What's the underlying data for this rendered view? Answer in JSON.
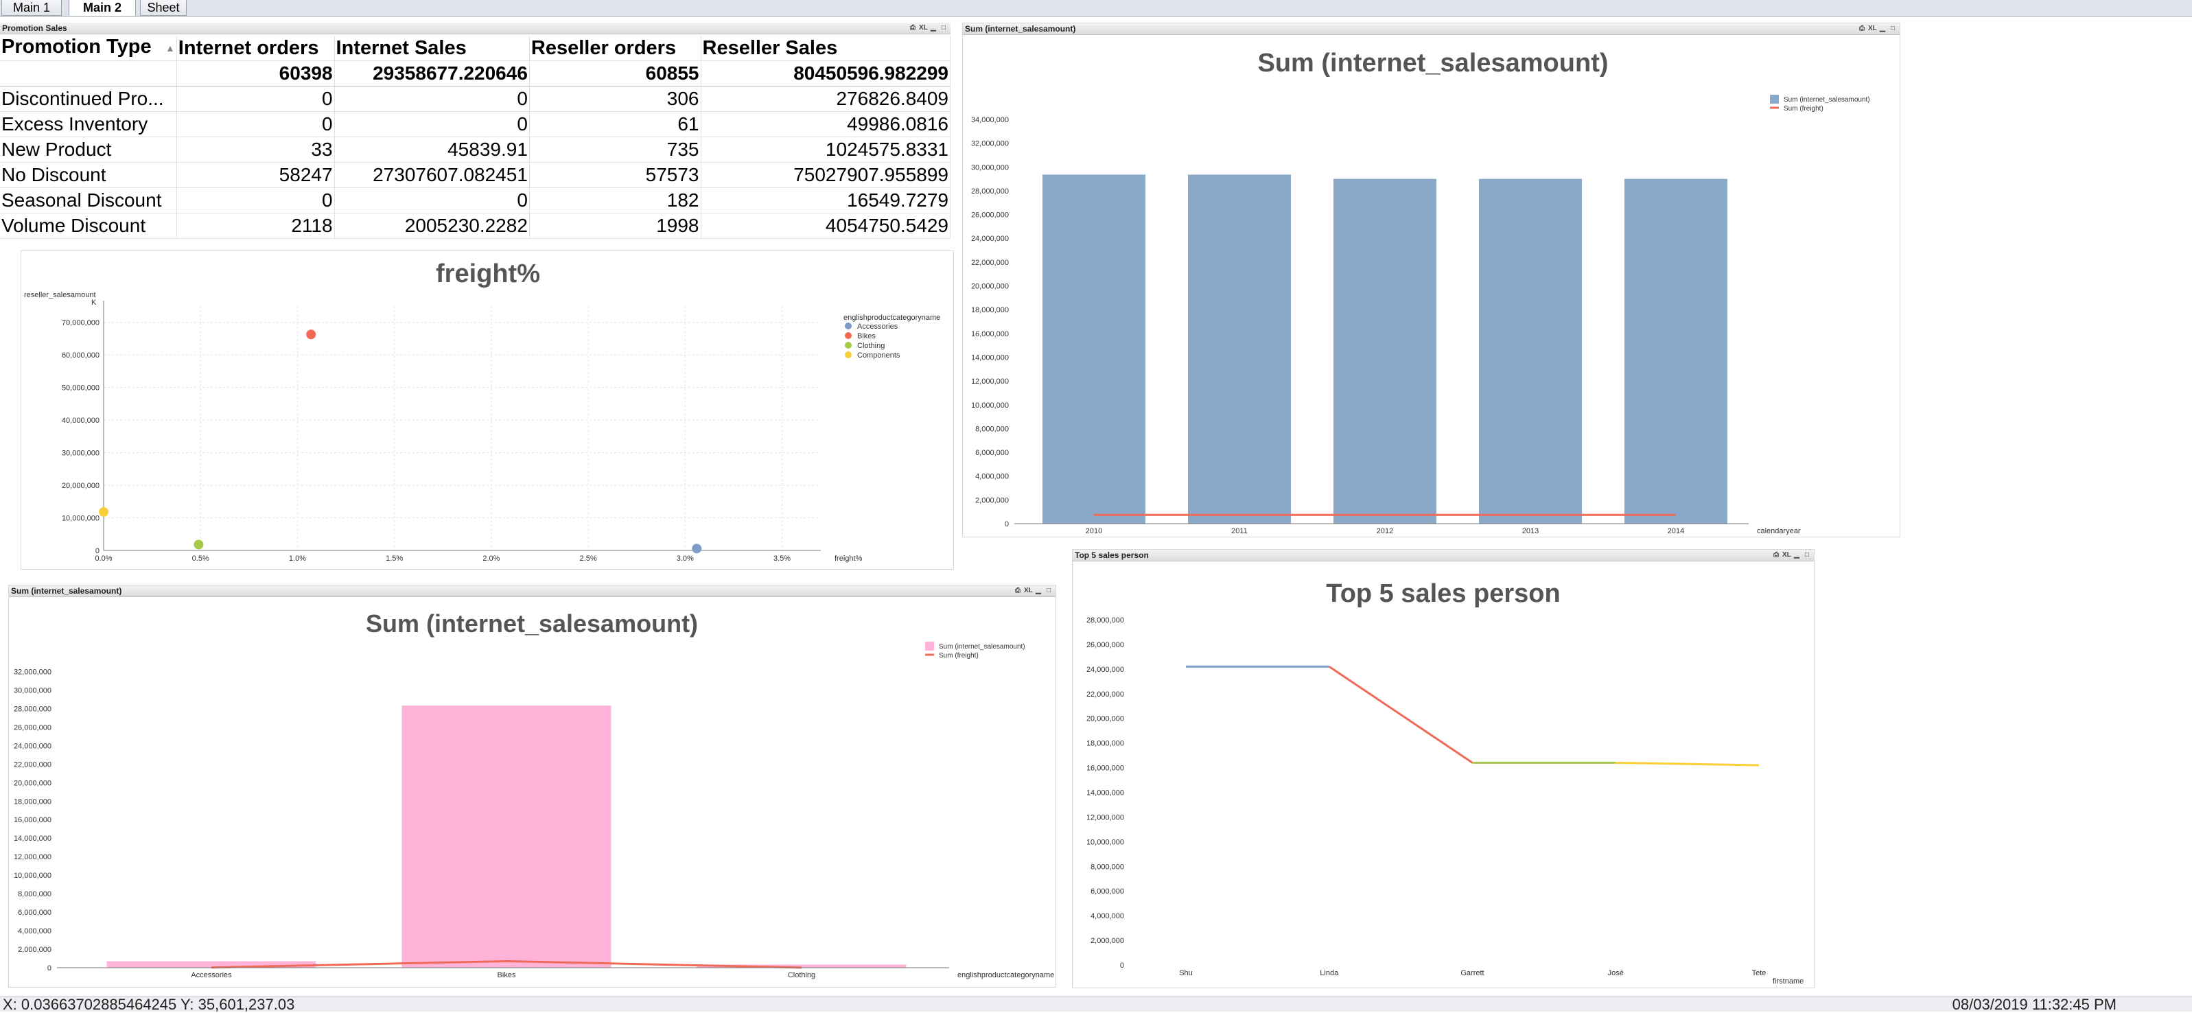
{
  "tabs": [
    "Main 1",
    "Main 2",
    "Sheet"
  ],
  "active_tab": "Main 2",
  "caption_icons": [
    "print-icon",
    "xl-icon",
    "minimize-icon",
    "maximize-icon"
  ],
  "promotion_table": {
    "caption": "Promotion Sales",
    "headers": [
      "Promotion Type",
      "Internet orders",
      "Internet Sales",
      "Reseller orders",
      "Reseller Sales"
    ],
    "totals": [
      "",
      "60398",
      "29358677.220646",
      "60855",
      "80450596.982299"
    ],
    "rows": [
      [
        "Discontinued Pro...",
        "0",
        "0",
        "306",
        "276826.8409"
      ],
      [
        "Excess Inventory",
        "0",
        "0",
        "61",
        "49986.0816"
      ],
      [
        "New Product",
        "33",
        "45839.91",
        "735",
        "1024575.8331"
      ],
      [
        "No Discount",
        "58247",
        "27307607.082451",
        "57573",
        "75027907.955899"
      ],
      [
        "Seasonal Discount",
        "0",
        "0",
        "182",
        "16549.7279"
      ],
      [
        "Volume Discount",
        "2118",
        "2005230.2282",
        "1998",
        "4054750.5429"
      ]
    ]
  },
  "chart_data": [
    {
      "id": "freight-scatter",
      "type": "scatter",
      "title": "freight%",
      "xlabel": "freight%",
      "ylabel": "reseller_salesamount",
      "ylabel_unit": "K",
      "legend_title": "englishproductcategoryname",
      "legend_position": "right",
      "xlim": [
        0,
        3.7
      ],
      "ylim": [
        0,
        75000000
      ],
      "x_ticks": [
        "0.0%",
        "0.5%",
        "1.0%",
        "1.5%",
        "2.0%",
        "2.5%",
        "3.0%",
        "3.5%"
      ],
      "y_ticks": [
        "0",
        "10,000,000",
        "20,000,000",
        "30,000,000",
        "40,000,000",
        "50,000,000",
        "60,000,000",
        "70,000,000"
      ],
      "grid": true,
      "series": [
        {
          "name": "Accessories",
          "color": "#7f9cc7",
          "x": 3.06,
          "y": 571000
        },
        {
          "name": "Bikes",
          "color": "#ef6b57",
          "x": 1.07,
          "y": 66300000
        },
        {
          "name": "Clothing",
          "color": "#a6c94a",
          "x": 0.49,
          "y": 1800000
        },
        {
          "name": "Components",
          "color": "#f7cf3b",
          "x": 0.0,
          "y": 11800000
        }
      ]
    },
    {
      "id": "year-bar",
      "type": "bar",
      "caption": "Sum (internet_salesamount)",
      "title": "Sum (internet_salesamount)",
      "xlabel": "calendaryear",
      "legend_position": "top-right",
      "categories": [
        "2010",
        "2011",
        "2012",
        "2013",
        "2014"
      ],
      "ylim": [
        0,
        34000000
      ],
      "y_ticks": [
        "0",
        "2,000,000",
        "4,000,000",
        "6,000,000",
        "8,000,000",
        "10,000,000",
        "12,000,000",
        "14,000,000",
        "16,000,000",
        "18,000,000",
        "20,000,000",
        "22,000,000",
        "24,000,000",
        "26,000,000",
        "28,000,000",
        "30,000,000",
        "32,000,000",
        "34,000,000"
      ],
      "series": [
        {
          "name": "Sum (internet_salesamount)",
          "kind": "bar",
          "color": "#8aa8c9",
          "values": [
            29358677,
            29358677,
            29000000,
            29000000,
            29000000
          ]
        },
        {
          "name": "Sum (freight)",
          "kind": "line",
          "color": "#ef6b57",
          "values": [
            733967,
            733967,
            733967,
            733967,
            733967
          ]
        }
      ]
    },
    {
      "id": "category-bar",
      "type": "bar",
      "caption": "Sum (internet_salesamount)",
      "title": "Sum (internet_salesamount)",
      "xlabel": "englishproductcategoryname",
      "legend_position": "top-right",
      "categories": [
        "Accessories",
        "Bikes",
        "Clothing"
      ],
      "ylim": [
        0,
        33000000
      ],
      "y_ticks": [
        "0",
        "2,000,000",
        "4,000,000",
        "6,000,000",
        "8,000,000",
        "10,000,000",
        "12,000,000",
        "14,000,000",
        "16,000,000",
        "18,000,000",
        "20,000,000",
        "22,000,000",
        "24,000,000",
        "26,000,000",
        "28,000,000",
        "30,000,000",
        "32,000,000"
      ],
      "series": [
        {
          "name": "Sum (internet_salesamount)",
          "kind": "bar",
          "color": "#ffb3d9",
          "values": [
            700760,
            28318145,
            339773
          ]
        },
        {
          "name": "Sum (freight)",
          "kind": "line",
          "color": "#ef6b57",
          "values": [
            17519,
            707954,
            8494
          ]
        }
      ]
    },
    {
      "id": "top5-line",
      "type": "line",
      "caption": "Top 5 sales person",
      "title": "Top 5 sales person",
      "xlabel": "firstname",
      "categories": [
        "Shu",
        "Linda",
        "Garrett",
        "José",
        "Tete"
      ],
      "ylim": [
        0,
        28000000
      ],
      "y_ticks": [
        "0",
        "2,000,000",
        "4,000,000",
        "6,000,000",
        "8,000,000",
        "10,000,000",
        "12,000,000",
        "14,000,000",
        "16,000,000",
        "18,000,000",
        "20,000,000",
        "22,000,000",
        "24,000,000",
        "26,000,000",
        "28,000,000"
      ],
      "values": [
        24200000,
        24200000,
        16400000,
        16400000,
        16200000
      ],
      "segment_colors": [
        "#7f9cc7",
        "#ef6b57",
        "#a6c94a",
        "#f7cf3b"
      ]
    }
  ],
  "status": {
    "coords": "X: 0.03663702885464245  Y: 35,601,237.03",
    "datetime": "08/03/2019 11:32:45 PM"
  }
}
